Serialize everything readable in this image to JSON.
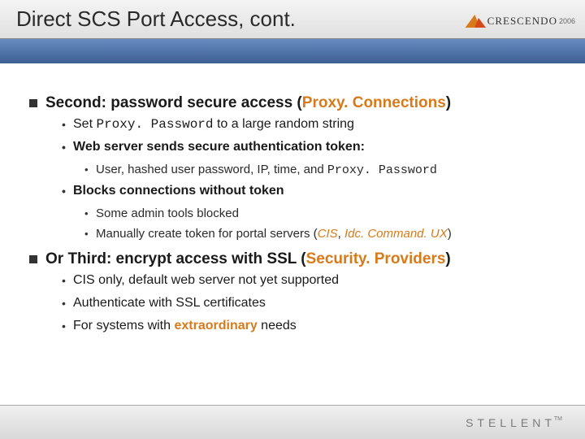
{
  "header": {
    "title": "Direct SCS Port Access, cont.",
    "brand_name": "CRESCENDO",
    "brand_year": "2006"
  },
  "content": {
    "section1": {
      "heading_prefix": "Second: password secure access (",
      "heading_keyword": "Proxy. Connections",
      "heading_suffix": ")",
      "b1_pre": "Set ",
      "b1_mono": "Proxy. Password",
      "b1_post": " to a large random string",
      "b2": "Web server sends secure authentication token:",
      "b2_sub_pre": "User, hashed user password, IP, time, and ",
      "b2_sub_mono": "Proxy. Password",
      "b3": "Blocks connections without token",
      "b3_sub1": "Some admin tools blocked",
      "b3_sub2_pre": "Manually create token for portal servers (",
      "b3_sub2_kw1": "CIS",
      "b3_sub2_mid": ", ",
      "b3_sub2_kw2": "Idc. Command. UX",
      "b3_sub2_post": ")"
    },
    "section2": {
      "heading_prefix": "Or Third: encrypt access with SSL (",
      "heading_keyword": "Security. Providers",
      "heading_suffix": ")",
      "b1": "CIS only, default web server not yet supported",
      "b2": "Authenticate with SSL certificates",
      "b3_pre": "For systems with ",
      "b3_kw": "extraordinary",
      "b3_post": " needs"
    }
  },
  "footer": {
    "brand": "STELLENT",
    "tm": "TM"
  }
}
